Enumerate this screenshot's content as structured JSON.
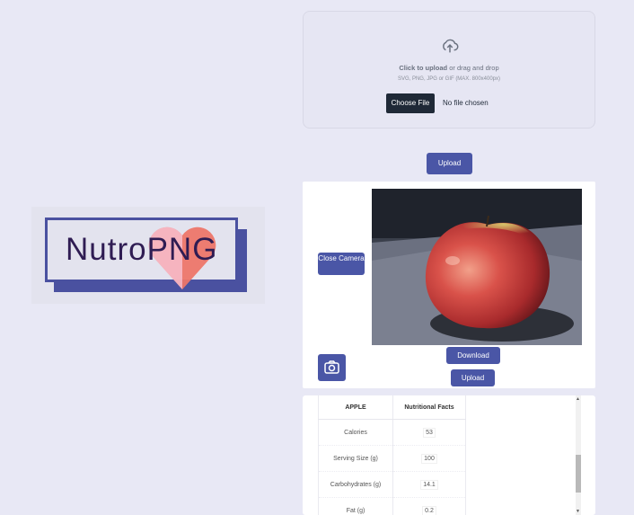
{
  "logo": {
    "text": "NutroPNG"
  },
  "dropzone": {
    "click_text": "Click to upload",
    "rest_text": " or drag and drop",
    "hint": "SVG, PNG, JPG or GIF (MAX. 800x400px)",
    "choose_label": "Choose File",
    "no_file": "No file chosen",
    "icon": "upload-cloud-icon"
  },
  "upload_button": "Upload",
  "camera": {
    "close_label": "Close Camera",
    "download_label": "Download",
    "upload_label": "Upload",
    "capture_icon": "camera-icon",
    "photo": "apple-photo"
  },
  "table": {
    "headers": [
      "APPLE",
      "Nutritional Facts"
    ],
    "rows": [
      [
        "Calories",
        "53"
      ],
      [
        "Serving Size (g)",
        "100"
      ],
      [
        "Carbohydrates (g)",
        "14.1"
      ],
      [
        "Fat (g)",
        "0.2"
      ]
    ]
  },
  "colors": {
    "accent": "#4a56a6",
    "background": "#e8e8f5",
    "dark_button": "#1f2937"
  }
}
